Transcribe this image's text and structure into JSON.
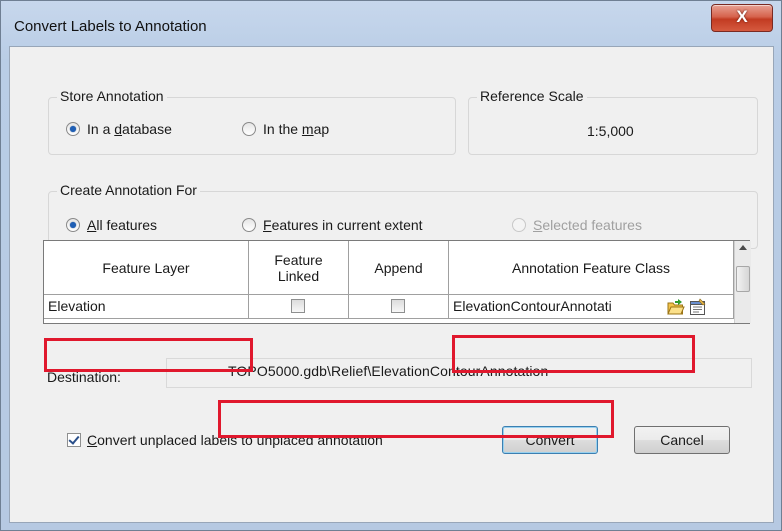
{
  "window": {
    "title": "Convert Labels to Annotation",
    "close_label": "X"
  },
  "store_annotation": {
    "title": "Store Annotation",
    "options": [
      {
        "pre": "In a ",
        "key": "d",
        "post": "atabase",
        "selected": true
      },
      {
        "pre": "In the ",
        "key": "m",
        "post": "ap",
        "selected": false
      }
    ]
  },
  "reference_scale": {
    "title": "Reference Scale",
    "value": "1:5,000"
  },
  "create_for": {
    "title": "Create Annotation For",
    "options": [
      {
        "pre": "",
        "key": "A",
        "post": "ll features",
        "selected": true,
        "enabled": true
      },
      {
        "pre": "",
        "key": "F",
        "post": "eatures in current extent",
        "selected": false,
        "enabled": true
      },
      {
        "pre": "",
        "key": "S",
        "post": "elected features",
        "selected": false,
        "enabled": false
      }
    ]
  },
  "grid": {
    "columns": [
      "Feature Layer",
      "Feature Linked",
      "Append",
      "Annotation Feature Class"
    ],
    "column_lines": [
      [
        "Feature Layer"
      ],
      [
        "Feature",
        "Linked"
      ],
      [
        "Append"
      ],
      [
        "Annotation Feature Class"
      ]
    ],
    "rows": [
      {
        "feature_layer": "Elevation",
        "feature_linked": false,
        "append": false,
        "annotation_class": "ElevationContourAnnotati"
      }
    ]
  },
  "destination": {
    "label": "Destination:",
    "value": "TOPO5000.gdb\\Relief\\ElevationContourAnnotation"
  },
  "convert_unplaced": {
    "key": "C",
    "post": "onvert unplaced labels to unplaced annotation",
    "checked": true
  },
  "buttons": {
    "convert": "Convert",
    "cancel": "Cancel"
  },
  "colors": {
    "highlight": "#e0182d",
    "radio_dot": "#1f5fb5"
  },
  "icons": [
    "open-folder-icon",
    "properties-icon",
    "scroll-up-arrow-icon"
  ]
}
